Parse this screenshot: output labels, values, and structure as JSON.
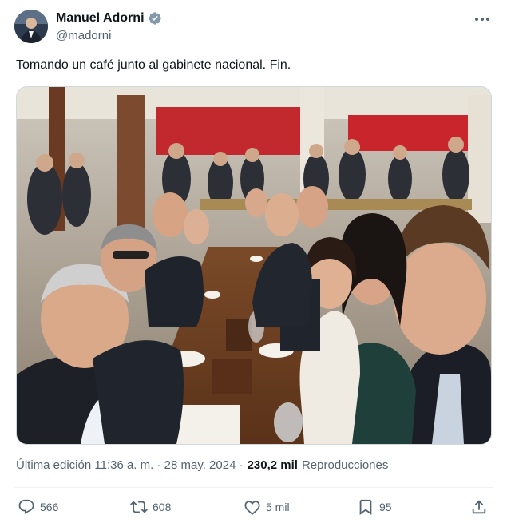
{
  "author": {
    "display_name": "Manuel Adorni",
    "handle": "@madorni"
  },
  "tweet": {
    "text": "Tomando un café junto al gabinete nacional. Fin."
  },
  "meta": {
    "edited_label": "Última edición 11:36 a. m. · 28 may. 2024 ·",
    "views_count": "230,2 mil",
    "views_label": "Reproducciones"
  },
  "actions": {
    "replies": "566",
    "reposts": "608",
    "likes": "5 mil",
    "bookmarks": "95"
  },
  "colors": {
    "text_primary": "#0f1419",
    "text_secondary": "#536471",
    "verified_badge": "#829aab",
    "divider": "#eff3f4"
  },
  "icons": [
    "verified-badge-icon",
    "more-icon",
    "reply-icon",
    "repost-icon",
    "like-icon",
    "bookmark-icon",
    "share-icon"
  ]
}
